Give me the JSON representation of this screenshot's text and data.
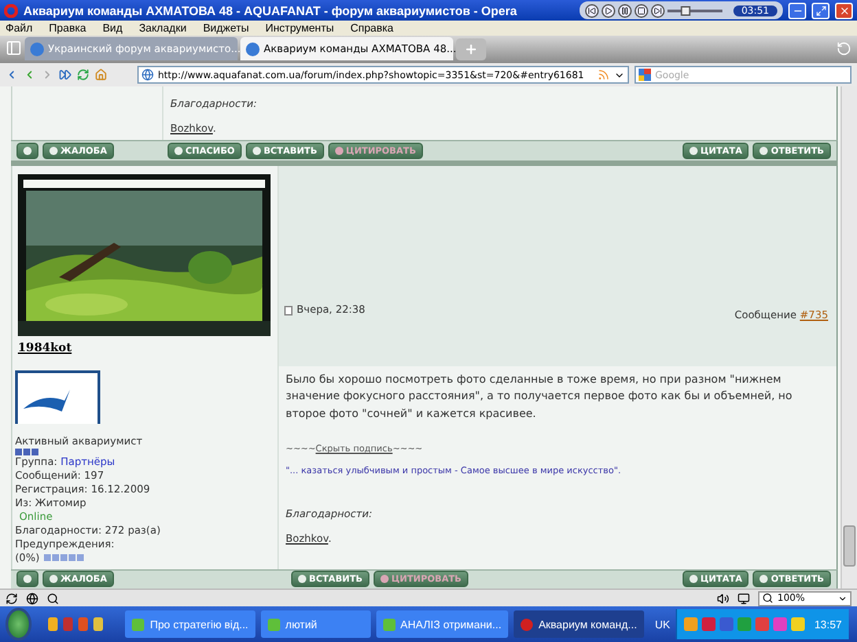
{
  "window": {
    "title": "Аквариум команды АХМАТОВА 48 - AQUAFANAT - форум аквариумистов - Opera"
  },
  "player": {
    "time": "03:51",
    "level": 0.3
  },
  "menu": [
    "Файл",
    "Правка",
    "Вид",
    "Закладки",
    "Виджеты",
    "Инструменты",
    "Справка"
  ],
  "tabs": [
    {
      "label": "Украинский форум аквариумисто...",
      "selected": false
    },
    {
      "label": "Аквариум команды АХМАТОВА 48...",
      "selected": true
    }
  ],
  "address_bar": {
    "url": "http://www.aquafanat.com.ua/forum/index.php?showtopic=3351&st=720&#entry61681",
    "search_placeholder": "Google"
  },
  "previous_post": {
    "thanks_label": "Благодарности:",
    "thanks_user": "Bozhkov",
    "thanks_end": "."
  },
  "top_buttons": {
    "left": [
      {
        "kind": "icon",
        "disabled": false
      },
      {
        "kind": "text",
        "label": "ЖАЛОБА",
        "disabled": false
      }
    ],
    "middle": [
      {
        "kind": "text",
        "label": "СПАСИБО",
        "disabled": false
      },
      {
        "kind": "text",
        "label": "ВСТАВИТЬ",
        "disabled": false
      },
      {
        "kind": "text",
        "label": "ЦИТИРОВАТЬ",
        "disabled": true
      }
    ],
    "right": [
      {
        "kind": "text",
        "label": "ЦИТАТА",
        "disabled": false
      },
      {
        "kind": "text",
        "label": "ОТВЕТИТЬ",
        "disabled": false
      }
    ]
  },
  "post": {
    "author": "1984kot",
    "date": "Вчера, 22:38",
    "number_label": "Сообщение",
    "number": "#735",
    "body": "Было бы хорошо посмотреть фото сделанные в тоже время, но при разном \"нижнем значение фокусного расстояния\", а то получается первое фото как бы и объемней, но второе фото \"сочней\" и кажется красивее.",
    "signature_prefix": "~~~~",
    "signature_toggle": "Скрыть подпись",
    "signature_suffix": "~~~~",
    "signature": "\"... казаться улыбчивым и простым - Самое высшее в мире искусство\".",
    "thanks_label": "Благодарности:",
    "thanks_user": "Bozhkov",
    "thanks_end": "."
  },
  "user_info": {
    "rank": "Активный аквариумист",
    "group_label": "Группа:",
    "group": "Партнёры",
    "posts": "Сообщений: 197",
    "registered": "Регистрация: 16.12.2009",
    "from": "Из: Житомир",
    "status": "Online",
    "thanks": "Благодарности: 272 раз(а)",
    "warnings_label": "Предупреждения:",
    "warnings_value": "(0%)"
  },
  "bottom_buttons": {
    "left": [
      {
        "kind": "icon",
        "disabled": false
      },
      {
        "kind": "text",
        "label": "ЖАЛОБА",
        "disabled": false
      }
    ],
    "middle": [
      {
        "kind": "text",
        "label": "ВСТАВИТЬ",
        "disabled": false
      },
      {
        "kind": "text",
        "label": "ЦИТИРОВАТЬ",
        "disabled": true
      }
    ],
    "right": [
      {
        "kind": "text",
        "label": "ЦИТАТА",
        "disabled": false
      },
      {
        "kind": "text",
        "label": "ОТВЕТИТЬ",
        "disabled": false
      }
    ]
  },
  "status_bar": {
    "zoom": "100%"
  },
  "taskbar": {
    "items": [
      {
        "label": "Про стратегію від...",
        "kind": "doc",
        "selected": false
      },
      {
        "label": "лютий",
        "kind": "doc",
        "selected": false
      },
      {
        "label": "АНАЛІЗ отримани...",
        "kind": "doc",
        "selected": false
      },
      {
        "label": "Аквариум команд...",
        "kind": "browser",
        "selected": true
      }
    ],
    "language": "UK",
    "clock": "13:57"
  }
}
